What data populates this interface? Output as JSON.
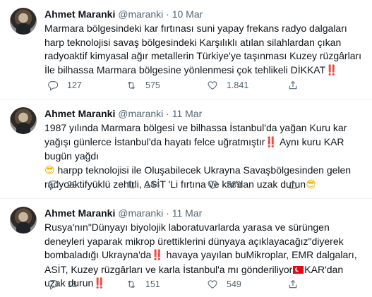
{
  "tweets": [
    {
      "name": "Ahmet Maranki",
      "handle": "@maranki",
      "sep": "·",
      "date": "10 Mar",
      "text": [
        "Marmara bölgesindeki kar fırtınası suni yapay frekans radyo dalgaları harp teknolojisi savaş bölgesindeki Karşılıklı atılan silahlardan çıkan radyoaktif kimyasal ağır metallerin Türkiye'ye taşınması Kuzey rüzgârları İle bilhassa Marmara bölgesine yönlenmesi çok tehlikeli DİKKAT"
      ],
      "emoji_end": "‼️",
      "replies": "127",
      "retweets": "575",
      "likes": "1.841"
    },
    {
      "name": "Ahmet Maranki",
      "handle": "@maranki",
      "sep": "·",
      "date": "11 Mar",
      "text_a": "1987 yılında Marmara bölgesi ve bilhassa İstanbul'da yağan Kuru kar yağışı günlerce İstanbul'da hayatı felce uğratmıştır",
      "text_b": " Aynı  kuru KAR bugün yağdı",
      "text_c": " harpp teknolojisi ile Oluşabilecek Ukrayna Savaşbölgesinden gelen radyoaktifyüklü zehirli, ASİT 'Li fırtına ve kar'dan uzak durun",
      "emoji_bang": "‼️",
      "emoji_smile": "😎",
      "replies": "22",
      "retweets": "144",
      "likes": "589"
    },
    {
      "name": "Ahmet Maranki",
      "handle": "@maranki",
      "sep": "·",
      "date": "11 Mar",
      "text_a": "Rusya'nın\"Dünyayı biyolojik laboratuvarlarda yarasa ve sürüngen deneyleri yaparak mikrop ürettiklerini dünyaya açıklayacağız\"diyerek bombaladığı Ukrayna'da",
      "text_b": " havaya yayılan  buMikroplar, EMR dalgaları, ASİT, Kuzey rüzgârları ve karla İstanbul'a mı gönderiliyor",
      "text_c": "KAR'dan uzak durun",
      "emoji_bang": "‼️",
      "replies": "18",
      "retweets": "151",
      "likes": "549"
    }
  ]
}
